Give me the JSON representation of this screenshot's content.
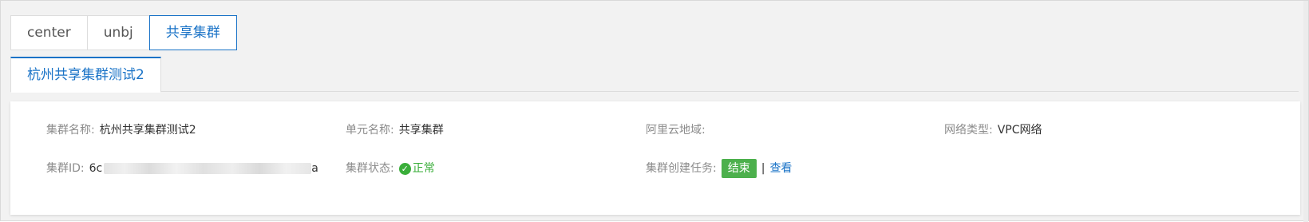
{
  "region_tabs": [
    {
      "label": "center",
      "active": false
    },
    {
      "label": "unbj",
      "active": false
    },
    {
      "label": "共享集群",
      "active": true
    }
  ],
  "cluster_tab": {
    "label": "杭州共享集群测试2"
  },
  "info": {
    "cluster_name_label": "集群名称:",
    "cluster_name_value": "杭州共享集群测试2",
    "unit_name_label": "单元名称:",
    "unit_name_value": "共享集群",
    "aliyun_region_label": "阿里云地域:",
    "aliyun_region_value": "",
    "network_type_label": "网络类型:",
    "network_type_value": "VPC网络",
    "cluster_id_label": "集群ID:",
    "cluster_id_prefix": "6c",
    "cluster_id_suffix": "a",
    "cluster_status_label": "集群状态:",
    "cluster_status_value": "正常",
    "create_task_label": "集群创建任务:",
    "create_task_badge": "结束",
    "create_task_separator": "|",
    "create_task_link": "查看"
  },
  "colors": {
    "accent": "#1a73c7",
    "success": "#3aae3a",
    "badge": "#4cb04c"
  },
  "icons": {
    "status_ok": "check-circle-icon"
  }
}
